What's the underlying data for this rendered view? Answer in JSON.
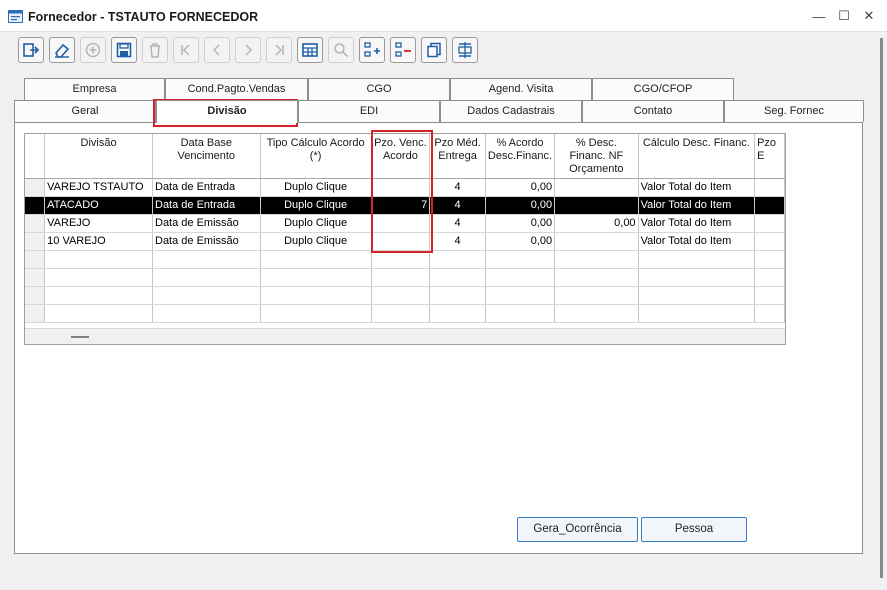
{
  "window": {
    "title": "Fornecedor - TSTAUTO FORNECEDOR",
    "controls": {
      "minimize": "—",
      "maximize": "☐",
      "close": "✕"
    }
  },
  "toolbar": {
    "buttons": [
      {
        "name": "exit",
        "icon": "exit-icon",
        "enabled": true
      },
      {
        "name": "clear",
        "icon": "eraser-icon",
        "enabled": true
      },
      {
        "name": "add",
        "icon": "plus-circle-icon",
        "enabled": false
      },
      {
        "name": "save",
        "icon": "save-icon",
        "enabled": true
      },
      {
        "name": "delete",
        "icon": "trash-icon",
        "enabled": false
      },
      {
        "name": "first",
        "icon": "first-icon",
        "enabled": false
      },
      {
        "name": "previous",
        "icon": "previous-icon",
        "enabled": false
      },
      {
        "name": "next",
        "icon": "next-icon",
        "enabled": false
      },
      {
        "name": "last",
        "icon": "last-icon",
        "enabled": false
      },
      {
        "name": "grid",
        "icon": "grid-icon",
        "enabled": true
      },
      {
        "name": "search",
        "icon": "search-icon",
        "enabled": false
      },
      {
        "name": "add-row",
        "icon": "add-row-icon",
        "enabled": true
      },
      {
        "name": "remove-row",
        "icon": "remove-row-icon",
        "enabled": true
      },
      {
        "name": "copy",
        "icon": "copy-icon",
        "enabled": true
      },
      {
        "name": "insert-row",
        "icon": "insert-row-icon",
        "enabled": true
      }
    ]
  },
  "tabs": {
    "back_row": [
      "Empresa",
      "Cond.Pagto.Vendas",
      "CGO",
      "Agend. Visita",
      "CGO/CFOP"
    ],
    "front_row": [
      "Geral",
      "Divisão",
      "EDI",
      "Dados Cadastrais",
      "Contato",
      "Seg. Fornec"
    ],
    "active": "Divisão"
  },
  "grid": {
    "columns": [
      "Divisão",
      "Data Base Vencimento",
      "Tipo Cálculo Acordo (*)",
      "Pzo. Venc. Acordo",
      "Pzo Méd. Entrega",
      "% Acordo Desc.Financ.",
      "% Desc. Financ. NF Orçamento",
      "Cálculo Desc. Financ.",
      "Pzo E"
    ],
    "rows": [
      {
        "divisao": "VAREJO TSTAUTO",
        "data_base": "Data de Entrada",
        "tipo_calculo": "Duplo Clique",
        "pzo_venc": "",
        "pzo_med": "4",
        "pct_acordo": "0,00",
        "pct_desc_nf": "",
        "calculo_desc": "Valor Total do Item",
        "active": false
      },
      {
        "divisao": "ATACADO",
        "data_base": "Data de Entrada",
        "tipo_calculo": "Duplo Clique",
        "pzo_venc": "7",
        "pzo_med": "4",
        "pct_acordo": "0,00",
        "pct_desc_nf": "",
        "calculo_desc": "Valor Total do Item",
        "active": true
      },
      {
        "divisao": "VAREJO",
        "data_base": "Data de Emissão",
        "tipo_calculo": "Duplo Clique",
        "pzo_venc": "",
        "pzo_med": "4",
        "pct_acordo": "0,00",
        "pct_desc_nf": "0,00",
        "calculo_desc": "Valor Total do Item",
        "active": false
      },
      {
        "divisao": "10 VAREJO",
        "data_base": "Data de Emissão",
        "tipo_calculo": "Duplo Clique",
        "pzo_venc": "",
        "pzo_med": "4",
        "pct_acordo": "0,00",
        "pct_desc_nf": "",
        "calculo_desc": "Valor Total do Item",
        "active": false
      }
    ],
    "empty_rows": 4
  },
  "buttons": {
    "gera_ocorrencia": "Gera_Ocorrência",
    "pessoa": "Pessoa"
  },
  "colors": {
    "highlight": "#d4242a",
    "active_row_bg": "#000000",
    "button_border": "#3b7bc4"
  }
}
